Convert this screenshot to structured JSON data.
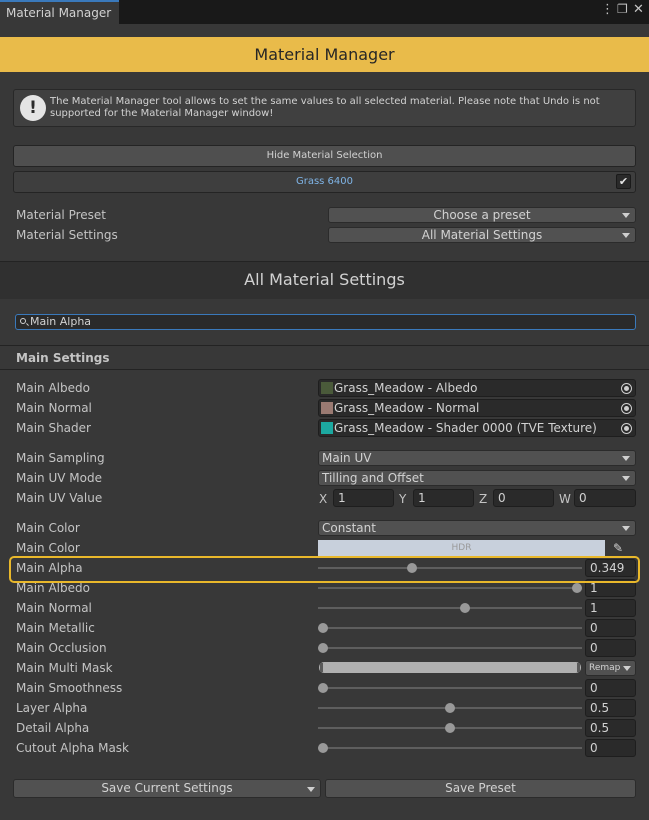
{
  "window": {
    "tab_title": "Material Manager",
    "menu_icon": "kebab-menu-icon",
    "maximize_icon": "maximize-icon",
    "close_icon": "close-icon"
  },
  "header": {
    "title": "Material Manager",
    "color": "#e9bb4a"
  },
  "help": {
    "icon": "exclamation-icon",
    "text": "The Material Manager tool allows to set the same values to all selected material. Please note that Undo is not supported for the Material Manager window!"
  },
  "selection": {
    "hide_button": "Hide Material Selection",
    "material_name": "Grass 6400",
    "material_checked": true
  },
  "preset": {
    "preset_label": "Material Preset",
    "preset_value": "Choose a preset",
    "settings_label": "Material Settings",
    "settings_value": "All Material Settings"
  },
  "settings_section": {
    "title": "All Material Settings"
  },
  "search": {
    "value": "Main Alpha"
  },
  "main_settings": {
    "heading": "Main Settings",
    "albedo": {
      "label": "Main Albedo",
      "value": "Grass_Meadow - Albedo"
    },
    "normal": {
      "label": "Main Normal",
      "value": "Grass_Meadow - Normal"
    },
    "shader": {
      "label": "Main Shader",
      "value": "Grass_Meadow - Shader 0000 (TVE Texture)"
    },
    "sampling": {
      "label": "Main Sampling",
      "value": "Main UV"
    },
    "uv_mode": {
      "label": "Main UV Mode",
      "value": "Tilling and Offset"
    },
    "uv_value": {
      "label": "Main UV Value",
      "x_label": "X",
      "x": "1",
      "y_label": "Y",
      "y": "1",
      "z_label": "Z",
      "z": "0",
      "w_label": "W",
      "w": "0"
    },
    "color_mode": {
      "label": "Main Color",
      "value": "Constant"
    },
    "color": {
      "label": "Main Color",
      "hdr": "HDR",
      "swatch": "#c8d0dc"
    },
    "sliders": [
      {
        "label": "Main Alpha",
        "value": "0.349",
        "fraction": 0.349,
        "highlighted": true
      },
      {
        "label": "Main Albedo",
        "value": "1",
        "fraction": 1.0
      },
      {
        "label": "Main Normal",
        "value": "1",
        "fraction": 0.56
      },
      {
        "label": "Main Metallic",
        "value": "0",
        "fraction": 0.0
      },
      {
        "label": "Main Occlusion",
        "value": "0",
        "fraction": 0.0
      }
    ],
    "multi_mask": {
      "label": "Main Multi Mask",
      "range": [
        0,
        1
      ],
      "mode": "Remap"
    },
    "sliders2": [
      {
        "label": "Main Smoothness",
        "value": "0",
        "fraction": 0.0
      },
      {
        "label": "Layer Alpha",
        "value": "0.5",
        "fraction": 0.5
      },
      {
        "label": "Detail Alpha",
        "value": "0.5",
        "fraction": 0.5
      },
      {
        "label": "Cutout Alpha Mask",
        "value": "0",
        "fraction": 0.0
      }
    ]
  },
  "footer": {
    "save_settings": "Save Current Settings",
    "save_preset": "Save Preset"
  }
}
